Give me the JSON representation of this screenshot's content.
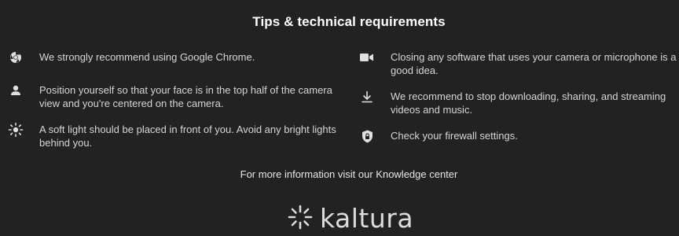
{
  "header": {
    "title": "Tips & technical requirements"
  },
  "tips_left": [
    {
      "icon": "chrome-icon",
      "text": "We strongly recommend using Google Chrome."
    },
    {
      "icon": "person-icon",
      "text": "Position yourself so that your face is in the top half of the camera view and you're centered on the camera."
    },
    {
      "icon": "light-icon",
      "text": "A soft light should be placed in front of you. Avoid any bright lights behind you."
    }
  ],
  "tips_right": [
    {
      "icon": "camera-icon",
      "text": "Closing any software that uses your camera or microphone is a good idea."
    },
    {
      "icon": "download-icon",
      "text": "We recommend to stop downloading, sharing, and streaming videos and music."
    },
    {
      "icon": "shield-lock-icon",
      "text": "Check your firewall settings."
    }
  ],
  "footer": {
    "info": "For more information visit our Knowledge center",
    "brand": "kaltura"
  },
  "colors": {
    "background": "#222222",
    "title": "#ffffff",
    "text": "#d6d6d6",
    "icon": "#e0e0e0"
  }
}
